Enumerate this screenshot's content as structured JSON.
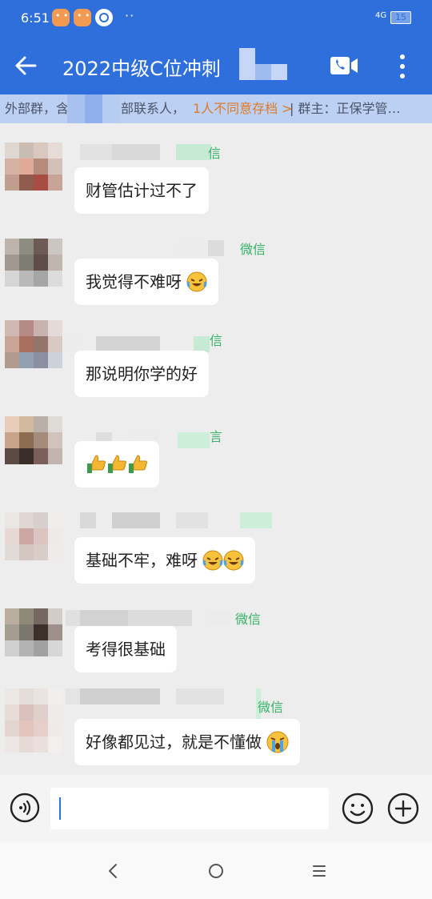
{
  "status_bar": {
    "time": "6:51",
    "dots": "··",
    "signal": "4G",
    "battery": "15"
  },
  "header": {
    "title": "2022中级C位冲刺"
  },
  "banner": {
    "part1": "外部群，含",
    "part2": "部联系人，",
    "objection": "1人不同意存档 >",
    "owner": "| 群主：正保学管…"
  },
  "messages": [
    {
      "tag": "信",
      "text": "财管估计过不了"
    },
    {
      "tag": "微信",
      "text": "我觉得不难呀",
      "emoji": [
        "laughing-crying"
      ]
    },
    {
      "tag": "信",
      "text": "那说明你学的好"
    },
    {
      "tag": "言",
      "text": "",
      "emoji": [
        "thumbs-up",
        "thumbs-up",
        "thumbs-up"
      ]
    },
    {
      "tag": "",
      "text": "基础不牢，难呀",
      "emoji": [
        "laughing-crying",
        "laughing-crying"
      ]
    },
    {
      "tag": "微信",
      "text": "考得很基础"
    },
    {
      "tag": "微信",
      "text": "好像都见过，就是不懂做",
      "emoji": [
        "crying"
      ]
    }
  ],
  "input": {
    "value": ""
  },
  "colors": {
    "primary": "#2f6fdc",
    "wechat_green": "#35b366",
    "warning_orange": "#e07a26"
  }
}
